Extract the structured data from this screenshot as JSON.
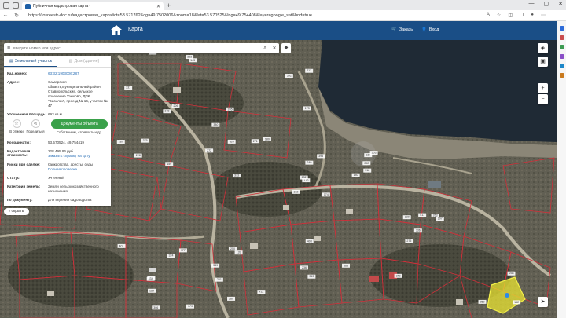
{
  "browser": {
    "tab_title": "Публичная кадастровая карта -",
    "url": "https://rosreestr-doc.ru/кадастровая_карта#ct=53.571762&cg=49.7502006&zoom=18&lat=53.570525&lng=49.754408&layer=google_sat&bnd=true"
  },
  "header": {
    "map_label": "Карта",
    "orders_label": "Заказы",
    "login_label": "Вход"
  },
  "search": {
    "placeholder": "введите номер или адрес"
  },
  "panel": {
    "tab_parcel": "Земельный участок",
    "tab_building": "Дом (здание)",
    "cad_number_label": "Кад.номер:",
    "cad_number_value": "63:32:1903006:287",
    "address_label": "Адрес:",
    "address_value": "Самарская область,муниципальный район Ставропольский, сельское поселение Узюково, ДПК \"Василек\", проезд № 16, участок № 47",
    "area_label": "Уточненная площадь:",
    "area_value": "693 кв.м",
    "favorites_label": "В отмеки",
    "share_label": "Поделиться",
    "documents_button": "Документы объекта",
    "documents_sub": "Собственник, стоимость и др.",
    "coords_label": "Координаты:",
    "coords_value": "53.570524, 49.754419",
    "value_label": "Кадастровая стоимость:",
    "value_amount": "228 495.96 руб.",
    "value_link": "заказать справку на дату",
    "risks_label": "Риски при сделке:",
    "risks_value": "банкротства, аресты, суды",
    "risks_link": "Полная проверка",
    "status_label": "Статус:",
    "status_value": "Учтенный",
    "category_label": "Категория земель:",
    "category_value": "Земли сельскохозяйственного назначения",
    "usage_label": "по документу:",
    "usage_value": "Для ведения садоводства",
    "collapse_label": "скрыть"
  },
  "map_controls": {
    "zoom_in": "+",
    "zoom_out": "−"
  },
  "parcel_labels": [
    "174",
    "178",
    "176",
    "181",
    "137",
    "139",
    "140",
    "143",
    "152",
    "159",
    "162",
    "171",
    "173",
    "177",
    "180",
    "184",
    "201",
    "203",
    "207",
    "209",
    "212",
    "228",
    "230",
    "232",
    "236",
    "240",
    "245",
    "250",
    "252",
    "258",
    "263",
    "271",
    "272",
    "275",
    "280",
    "287",
    "292",
    "306",
    "313",
    "318",
    "324",
    "331",
    "336",
    "342",
    "349",
    "353",
    "359",
    "368",
    "373",
    "375",
    "380",
    "386",
    "392",
    "395",
    "401",
    "408",
    "412",
    "417",
    "426",
    "434"
  ]
}
